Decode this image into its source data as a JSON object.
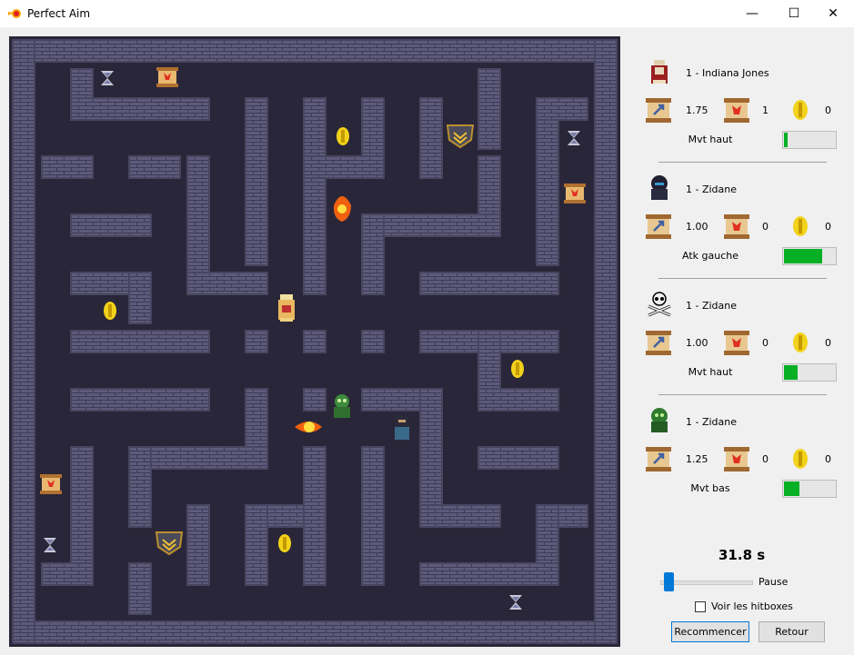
{
  "window": {
    "title": "Perfect Aim",
    "minimize_glyph": "—",
    "maximize_glyph": "☐",
    "close_glyph": "✕"
  },
  "players": [
    {
      "name": "1 - Indiana Jones",
      "avatar": "wizard-icon",
      "speed": "1.75",
      "bombs": "1",
      "coins": "0",
      "action": "Mvt haut",
      "progress": 0.08
    },
    {
      "name": "1 - Zidane",
      "avatar": "hooded-ninja-icon",
      "speed": "1.00",
      "bombs": "0",
      "coins": "0",
      "action": "Atk gauche",
      "progress": 0.75
    },
    {
      "name": "1 - Zidane",
      "avatar": "skull-bones-icon",
      "speed": "1.00",
      "bombs": "0",
      "coins": "0",
      "action": "Mvt haut",
      "progress": 0.27
    },
    {
      "name": "1 - Zidane",
      "avatar": "green-goblin-icon",
      "speed": "1.25",
      "bombs": "0",
      "coins": "0",
      "action": "Mvt bas",
      "progress": 0.3
    }
  ],
  "stat_icons": [
    "speed-scroll-icon",
    "bomb-scroll-icon",
    "coin-icon"
  ],
  "timer": "31.8 s",
  "speed_slider_value": 0.05,
  "pause_label": "Pause",
  "hitbox_label": "Voir les hitboxes",
  "hitbox_checked": false,
  "buttons": {
    "restart": "Recommencer",
    "back": "Retour"
  },
  "colors": {
    "maze_floor": "#2a2639",
    "wall": "#5d5a7b",
    "wall_mortar": "#3e3b55",
    "progress": "#06b025",
    "accent": "#0078d7"
  },
  "map_items": [
    {
      "type": "hourglass-icon"
    },
    {
      "type": "hourglass-icon"
    },
    {
      "type": "hourglass-icon"
    },
    {
      "type": "hourglass-icon"
    },
    {
      "type": "bomb-scroll-icon"
    },
    {
      "type": "bomb-scroll-icon"
    },
    {
      "type": "bomb-scroll-icon"
    },
    {
      "type": "coin-icon"
    },
    {
      "type": "coin-icon"
    },
    {
      "type": "coin-icon"
    },
    {
      "type": "coin-icon"
    },
    {
      "type": "shield-crest-icon"
    },
    {
      "type": "shield-crest-icon"
    },
    {
      "type": "fireball-icon"
    },
    {
      "type": "fireball-icon"
    }
  ],
  "map_characters": [
    "wizard-icon",
    "green-goblin-icon",
    "hooded-ninja-icon"
  ]
}
